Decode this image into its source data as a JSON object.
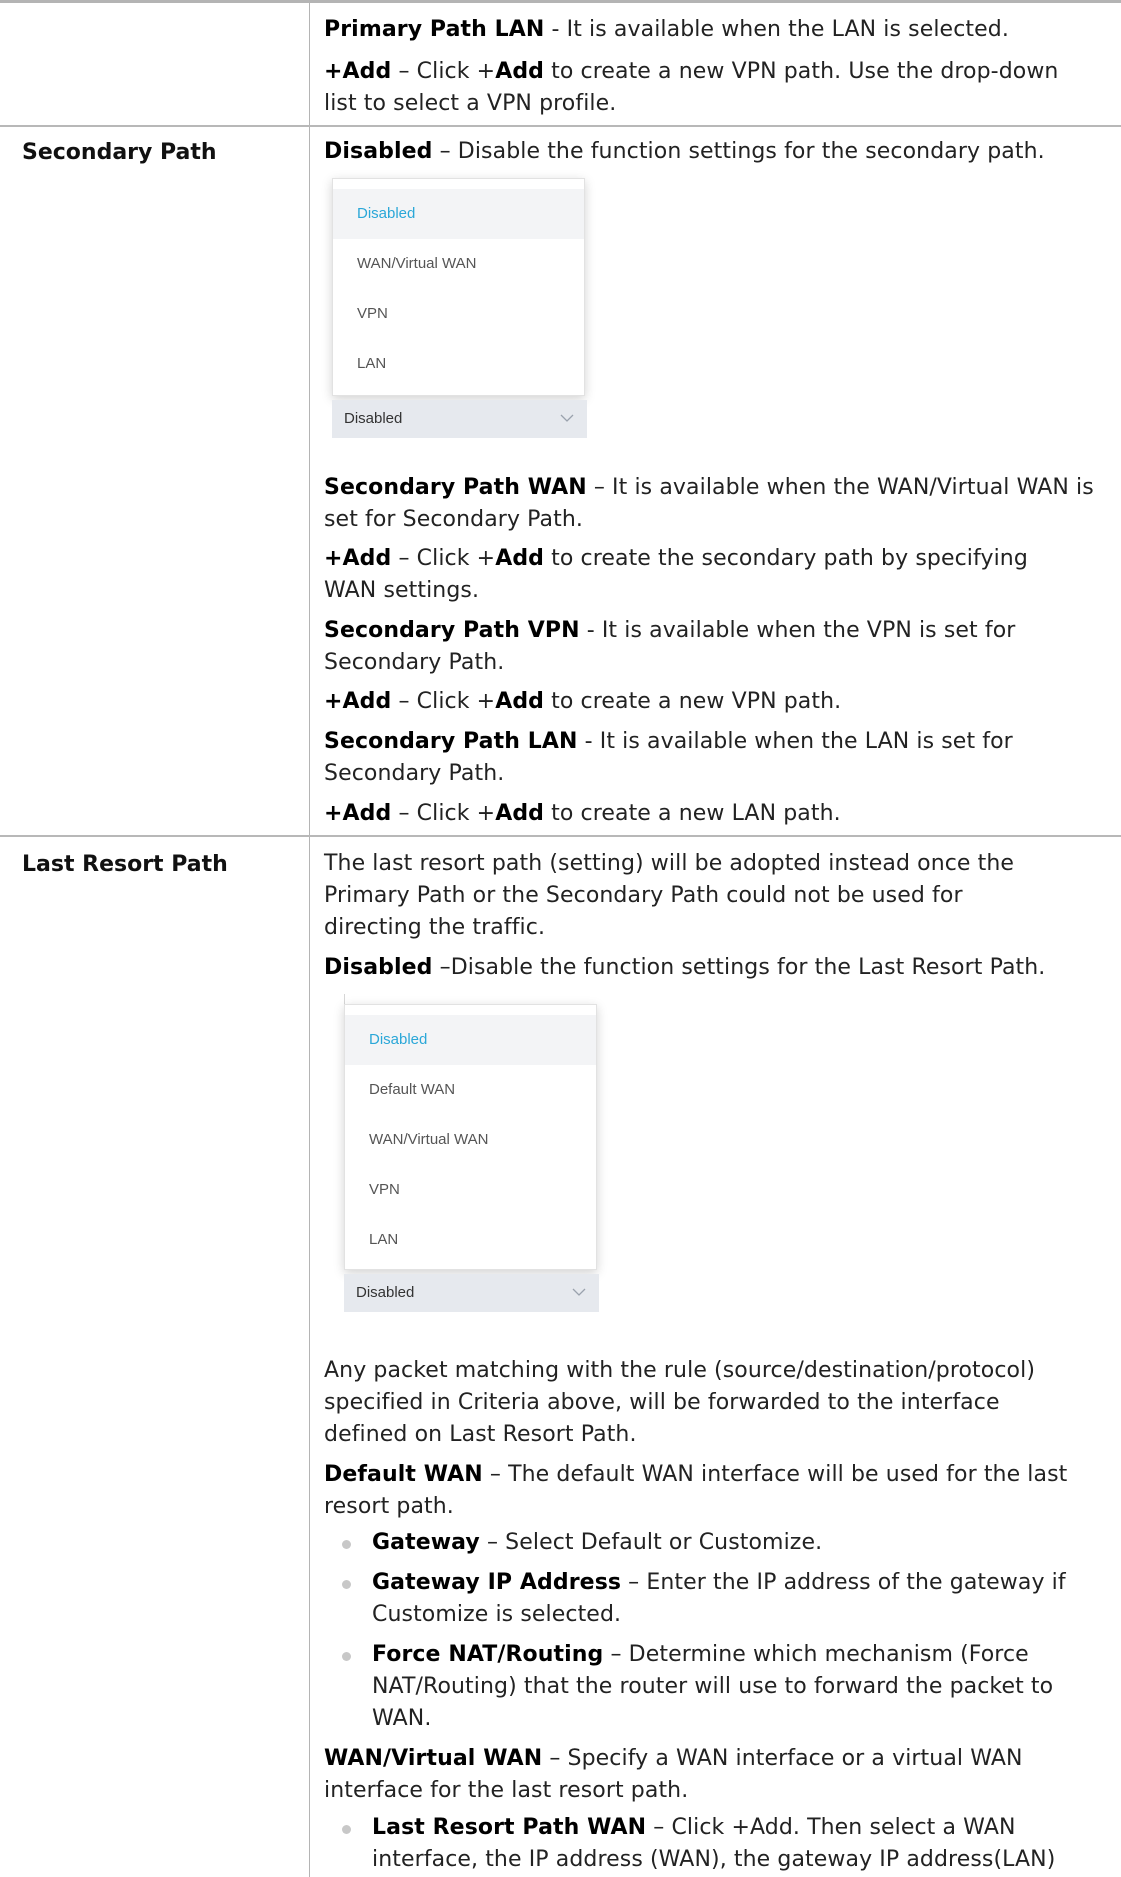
{
  "primary": {
    "lan_term": "Primary Path LAN",
    "lan_desc": " - It is available when the LAN is selected.",
    "add_term": "+Add",
    "add_desc_1": " – Click +",
    "add_word": "Add",
    "add_desc_2": " to create a new VPN path. Use the drop-down",
    "add_desc_line2": "list to select a VPN profile."
  },
  "secondary": {
    "param": "Secondary Path",
    "disabled_term": "Disabled",
    "disabled_desc": " – Disable the function settings for the secondary path.",
    "dropdown": {
      "options": [
        "Disabled",
        "WAN/Virtual WAN",
        "VPN",
        "LAN"
      ],
      "selected": "Disabled"
    },
    "wan_term": "Secondary Path WAN",
    "wan_desc": " – It is available when the WAN/Virtual WAN is",
    "wan_desc_line2": "set for Secondary Path.",
    "add1_term": "+Add",
    "add1_desc": " – Click +",
    "add_word": "Add",
    "add1_desc2": " to create the secondary path by specifying",
    "add1_line2": "WAN settings.",
    "vpn_term": "Secondary Path VPN",
    "vpn_desc": " - It is available when the VPN is set for",
    "vpn_line2": "Secondary Path.",
    "add2_term": "+Add",
    "add2_desc": " – Click +",
    "add2_desc2": " to create a new VPN path.",
    "lan_term": "Secondary Path LAN",
    "lan_desc": " - It is available when the LAN is set for",
    "lan_line2": "Secondary Path.",
    "add3_term": "+Add",
    "add3_desc": " – Click +",
    "add3_desc2": " to create a new LAN path."
  },
  "last_resort": {
    "param": "Last Resort Path",
    "intro_1": "The last resort path (setting) will be adopted instead once the",
    "intro_2": "Primary Path or the Secondary Path could not be used for",
    "intro_3": "directing the traffic.",
    "disabled_term": "Disabled",
    "disabled_desc": " –Disable the function settings for the Last Resort Path.",
    "dropdown": {
      "options": [
        "Disabled",
        "Default WAN",
        "WAN/Virtual WAN",
        "VPN",
        "LAN"
      ],
      "selected": "Disabled"
    },
    "match_1": "Any packet matching with the rule (source/destination/protocol)",
    "match_2": "specified in Criteria above, will be forwarded to the interface",
    "match_3": "defined on Last Resort Path.",
    "default_wan_term": "Default WAN",
    "default_wan_desc": " – The default WAN interface will be used for the last",
    "default_wan_line2": "resort path.",
    "bullets": [
      {
        "term": "Gateway",
        "desc": " – Select Default or Customize."
      },
      {
        "term": "Gateway IP Address",
        "desc": " – Enter the IP address of the gateway if",
        "line2": "Customize is selected."
      },
      {
        "term": "Force NAT/Routing",
        "desc": " – Determine which mechanism (Force",
        "line2": "NAT/Routing) that the router will use to forward the packet to",
        "line3": "WAN."
      }
    ],
    "vwan_term": "WAN/Virtual WAN",
    "vwan_desc": " – Specify a WAN interface or a virtual WAN",
    "vwan_line2": "interface for the last resort path.",
    "lrp_wan_term": "Last Resort Path WAN",
    "lrp_wan_desc": " – Click +Add. Then select a WAN",
    "lrp_wan_line2": "interface, the IP address (WAN), the gateway IP address(LAN)"
  }
}
